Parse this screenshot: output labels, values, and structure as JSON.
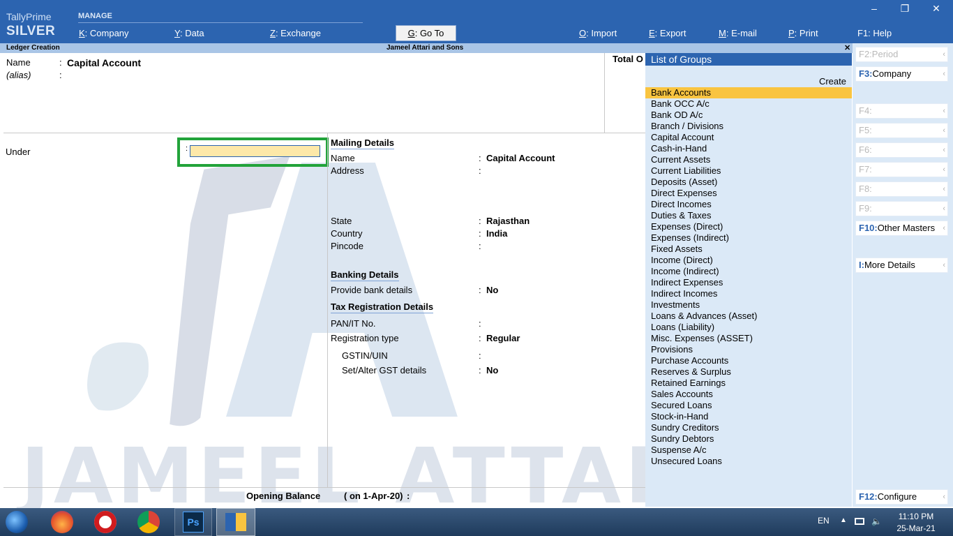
{
  "app": {
    "brand_line1": "TallyPrime",
    "brand_line2": "SILVER",
    "manage_label": "MANAGE"
  },
  "menu": [
    {
      "key": "K",
      "label": ": Company"
    },
    {
      "key": "Y",
      "label": ": Data"
    },
    {
      "key": "Z",
      "label": ": Exchange"
    },
    {
      "key": "G",
      "label": ": Go To"
    },
    {
      "key": "O",
      "label": ": Import"
    },
    {
      "key": "E",
      "label": ": Export"
    },
    {
      "key": "M",
      "label": ": E-mail"
    },
    {
      "key": "P",
      "label": ": Print"
    },
    {
      "key": "F1",
      "label": ": Help"
    }
  ],
  "window_controls": {
    "minimize": "–",
    "restore": "❐",
    "close": "✕"
  },
  "subheader": {
    "screen_title": "Ledger Creation",
    "company": "Jameel Attari and Sons",
    "close": "✕"
  },
  "form": {
    "name_label": "Name",
    "name_sep": ":",
    "name_value": "Capital Account",
    "alias_label": "(alias)",
    "alias_sep": ":",
    "total_label": "Total O",
    "under_label": "Under",
    "under_sep": ":",
    "under_value": ""
  },
  "mailing": {
    "heading": "Mailing Details",
    "name_label": "Name",
    "name_value": "Capital Account",
    "address_label": "Address",
    "address_value": "",
    "state_label": "State",
    "state_value": "Rajasthan",
    "country_label": "Country",
    "country_value": "India",
    "pincode_label": "Pincode",
    "pincode_value": "",
    "sep": ":"
  },
  "banking": {
    "heading": "Banking Details",
    "provide_label": "Provide bank details",
    "provide_value": "No"
  },
  "tax": {
    "heading": "Tax Registration Details",
    "pan_label": "PAN/IT No.",
    "pan_value": "",
    "regtype_label": "Registration type",
    "regtype_value": "Regular",
    "gstin_label": "GSTIN/UIN",
    "gstin_value": "",
    "setalter_label": "Set/Alter GST details",
    "setalter_value": "No"
  },
  "opening": {
    "label": "Opening Balance",
    "date_text": "( on 1-Apr-20)",
    "sep": ":"
  },
  "groups": {
    "title": "List of Groups",
    "create_label": "Create",
    "selected_index": 0,
    "items": [
      "Bank Accounts",
      "Bank OCC A/c",
      "Bank OD A/c",
      "Branch / Divisions",
      "Capital Account",
      "Cash-in-Hand",
      "Current Assets",
      "Current Liabilities",
      "Deposits (Asset)",
      "Direct Expenses",
      "Direct Incomes",
      "Duties & Taxes",
      "Expenses (Direct)",
      "Expenses (Indirect)",
      "Fixed Assets",
      "Income (Direct)",
      "Income (Indirect)",
      "Indirect Expenses",
      "Indirect Incomes",
      "Investments",
      "Loans & Advances (Asset)",
      "Loans (Liability)",
      "Misc. Expenses (ASSET)",
      "Provisions",
      "Purchase Accounts",
      "Reserves & Surplus",
      "Retained Earnings",
      "Sales Accounts",
      "Secured Loans",
      "Stock-in-Hand",
      "Sundry Creditors",
      "Sundry Debtors",
      "Suspense A/c",
      "Unsecured Loans"
    ]
  },
  "right_panel": [
    {
      "key": "F2",
      "label": "Period",
      "enabled": false
    },
    {
      "key": "F3",
      "label": "Company",
      "enabled": true
    },
    {
      "key": "F4",
      "label": "",
      "enabled": false
    },
    {
      "key": "F5",
      "label": "",
      "enabled": false
    },
    {
      "key": "F6",
      "label": "",
      "enabled": false
    },
    {
      "key": "F7",
      "label": "",
      "enabled": false
    },
    {
      "key": "F8",
      "label": "",
      "enabled": false
    },
    {
      "key": "F9",
      "label": "",
      "enabled": false
    },
    {
      "key": "F10",
      "label": "Other Masters",
      "enabled": true
    },
    {
      "key": "I",
      "label": "More Details",
      "enabled": true
    },
    {
      "key": "F12",
      "label": "Configure",
      "enabled": true
    }
  ],
  "watermark": {
    "text": "JAMEEL ATTARI"
  },
  "taskbar": {
    "lang": "EN",
    "time": "11:10 PM",
    "date": "25-Mar-21",
    "apps": [
      "start-orb-icon",
      "firefox-icon",
      "opera-icon",
      "chrome-icon",
      "photoshop-icon",
      "tally-icon"
    ],
    "photoshop_text": "Ps"
  },
  "colors": {
    "titlebar": "#2c64b0",
    "panel": "#dbe9f7",
    "selection": "#f9c440",
    "highlight_box": "#22a33a"
  }
}
